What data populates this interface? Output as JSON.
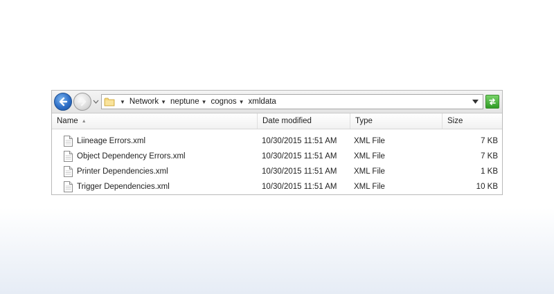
{
  "address": {
    "crumbs": [
      "Network",
      "neptune",
      "cognos",
      "xmldata"
    ]
  },
  "columns": {
    "name": "Name",
    "date": "Date modified",
    "type": "Type",
    "size": "Size"
  },
  "files": [
    {
      "name": "Liineage Errors.xml",
      "date": "10/30/2015 11:51 AM",
      "type": "XML File",
      "size": "7 KB"
    },
    {
      "name": "Object Dependency Errors.xml",
      "date": "10/30/2015 11:51 AM",
      "type": "XML File",
      "size": "7 KB"
    },
    {
      "name": "Printer Dependencies.xml",
      "date": "10/30/2015 11:51 AM",
      "type": "XML File",
      "size": "1 KB"
    },
    {
      "name": "Trigger Dependencies.xml",
      "date": "10/30/2015 11:51 AM",
      "type": "XML File",
      "size": "10 KB"
    }
  ],
  "icons": {
    "back": "back-arrow-icon",
    "forward": "forward-arrow-icon",
    "folder": "folder-icon",
    "refresh": "refresh-icon",
    "file": "xml-file-icon"
  },
  "colors": {
    "back_button": "#2f6fc7",
    "refresh_button": "#2f9a24"
  }
}
